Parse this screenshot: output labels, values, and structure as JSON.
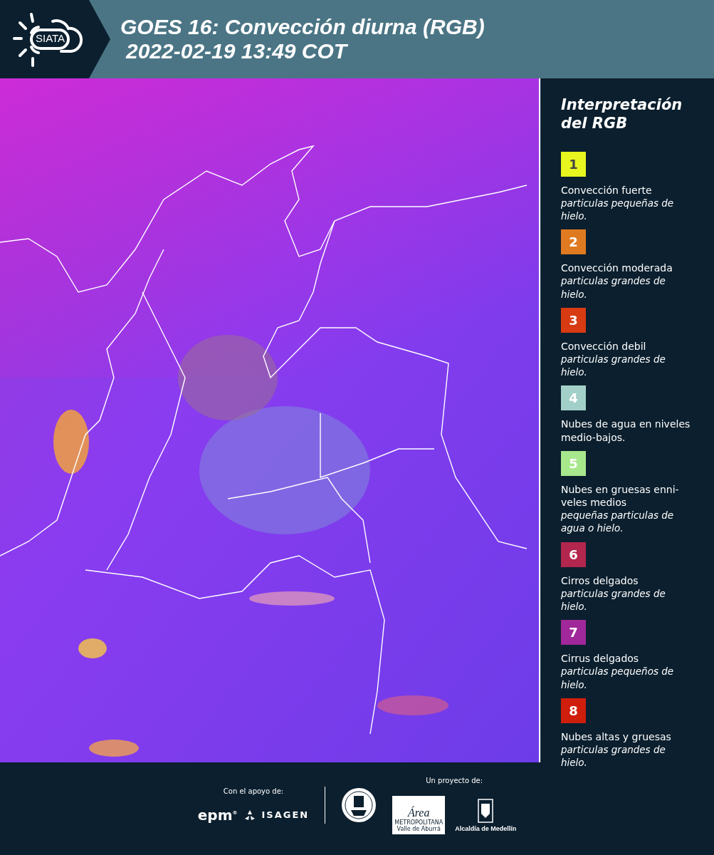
{
  "header": {
    "logo_text": "SIATA",
    "title": "GOES 16: Convección diurna (RGB)",
    "timestamp": "2022-02-19 13:49 COT"
  },
  "legend": {
    "title": "Interpretación del RGB",
    "items": [
      {
        "number": "1",
        "color": "#e8f51e",
        "title": "Convección fuerte",
        "description": "particulas pequeñas de hielo."
      },
      {
        "number": "2",
        "color": "#e07a20",
        "title": "Convección moderada",
        "description": "particulas grandes de hielo."
      },
      {
        "number": "3",
        "color": "#d83a12",
        "title": "Convección debil",
        "description": "particulas grandes de hielo."
      },
      {
        "number": "4",
        "color": "#a3cfc9",
        "title": "Nubes de agua en niveles medio-bajos."
      },
      {
        "number": "5",
        "color": "#a8e88c",
        "title": "Nubes en gruesas enni-veles medios",
        "description": "pequeñas particulas de agua o hielo."
      },
      {
        "number": "6",
        "color": "#b3264e",
        "title": "Cirros delgados",
        "description": "particulas grandes de hielo."
      },
      {
        "number": "7",
        "color": "#a0289a",
        "title": "Cirrus delgados",
        "description": "particulas pequeños de hielo."
      },
      {
        "number": "8",
        "color": "#cf1e0c",
        "title": "Nubes altas y gruesas",
        "description": "particulas grandes de hielo."
      }
    ]
  },
  "footer": {
    "support_label": "Con el apoyo de:",
    "project_label": "Un proyecto de:",
    "epm": "epm",
    "epm_mark": "®",
    "isagen": "ISAGEN",
    "area": "Área",
    "metropolitana": "METROPOLITANA",
    "valle": "Valle de Aburrá",
    "alcaldia": "Alcaldía de Medellín"
  }
}
